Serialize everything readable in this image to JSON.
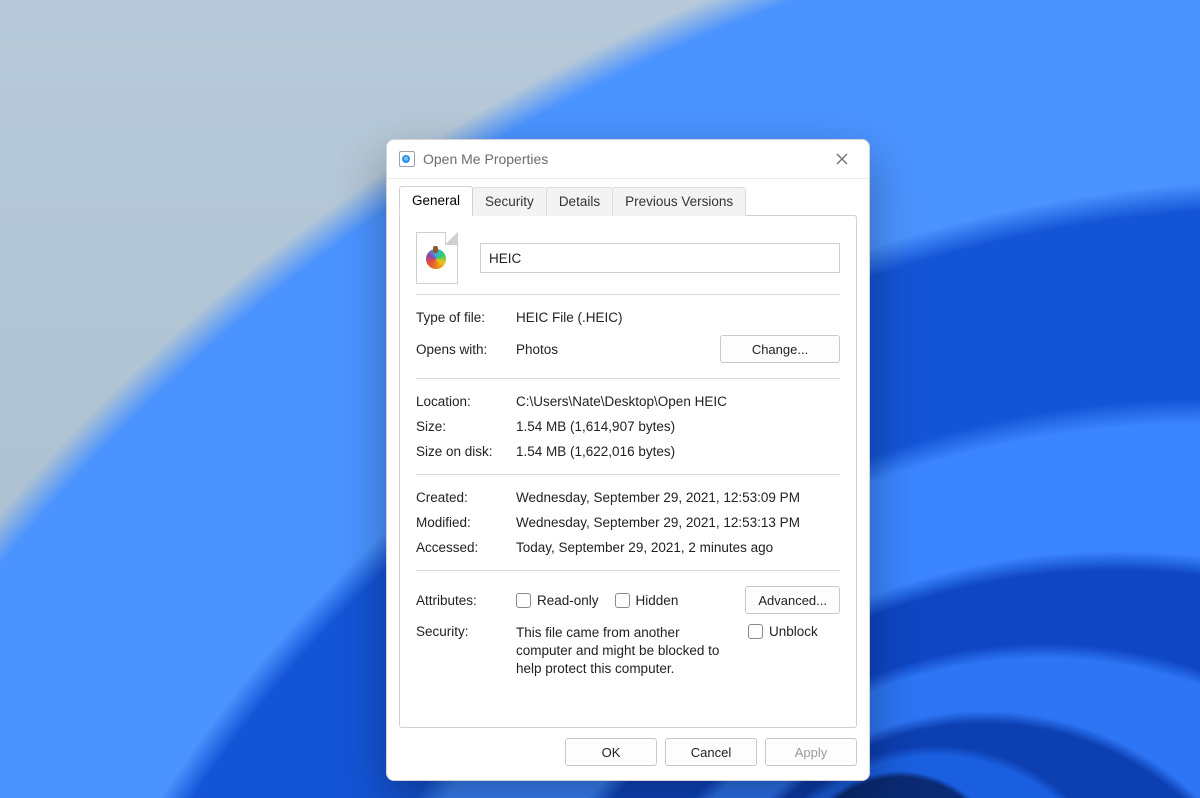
{
  "window": {
    "title": "Open Me Properties"
  },
  "tabs": {
    "general": "General",
    "security": "Security",
    "details": "Details",
    "previous": "Previous Versions"
  },
  "file": {
    "name": "HEIC",
    "type_label": "Type of file:",
    "type_value": "HEIC File (.HEIC)",
    "opens_label": "Opens with:",
    "opens_value": "Photos",
    "change_button": "Change...",
    "location_label": "Location:",
    "location_value": "C:\\Users\\Nate\\Desktop\\Open HEIC",
    "size_label": "Size:",
    "size_value": "1.54 MB (1,614,907 bytes)",
    "diskSize_label": "Size on disk:",
    "diskSize_value": "1.54 MB (1,622,016 bytes)",
    "created_label": "Created:",
    "created_value": "Wednesday, September 29, 2021, 12:53:09 PM",
    "modified_label": "Modified:",
    "modified_value": "Wednesday, September 29, 2021, 12:53:13 PM",
    "accessed_label": "Accessed:",
    "accessed_value": "Today, September 29, 2021, 2 minutes ago",
    "attributes_label": "Attributes:",
    "readonly_label": "Read-only",
    "hidden_label": "Hidden",
    "advanced_button": "Advanced...",
    "security_label": "Security:",
    "security_msg": "This file came from another computer and might be blocked to help protect this computer.",
    "unblock_label": "Unblock"
  },
  "buttons": {
    "ok": "OK",
    "cancel": "Cancel",
    "apply": "Apply"
  }
}
